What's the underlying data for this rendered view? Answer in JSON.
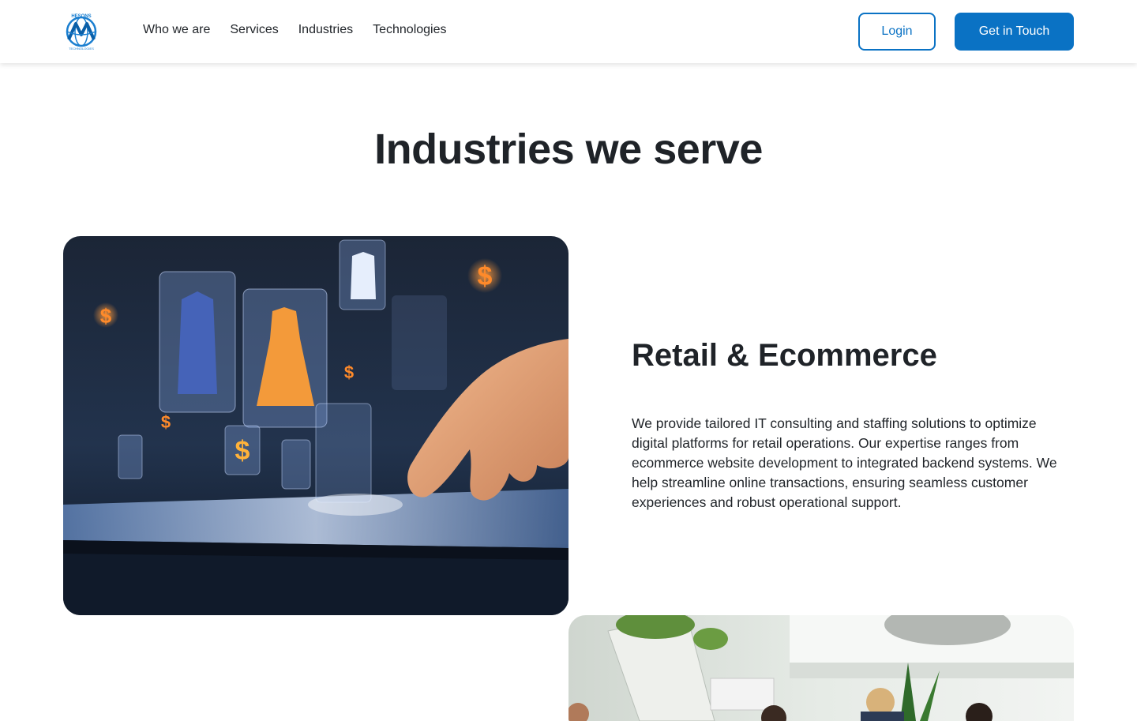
{
  "header": {
    "logo": {
      "icon": "globe-logo-icon",
      "top_text": "HESONS",
      "bottom_text": "TECHNOLOGIES"
    },
    "nav": [
      {
        "label": "Who we are"
      },
      {
        "label": "Services"
      },
      {
        "label": "Industries"
      },
      {
        "label": "Technologies"
      }
    ],
    "login_label": "Login",
    "cta_label": "Get in Touch"
  },
  "colors": {
    "accent": "#0a72c4",
    "text": "#1f2328",
    "background": "#ffffff"
  },
  "section": {
    "title": "Industries we serve"
  },
  "industries": [
    {
      "name": "Retail & Ecommerce",
      "description": "We provide tailored IT consulting and staffing solutions to optimize digital platforms for retail operations. Our expertise ranges from ecommerce website development to integrated backend systems. We help streamline online transactions, ensuring seamless customer experiences and robust operational support.",
      "image": "retail-hologram-image"
    },
    {
      "image": "office-meeting-image"
    }
  ]
}
